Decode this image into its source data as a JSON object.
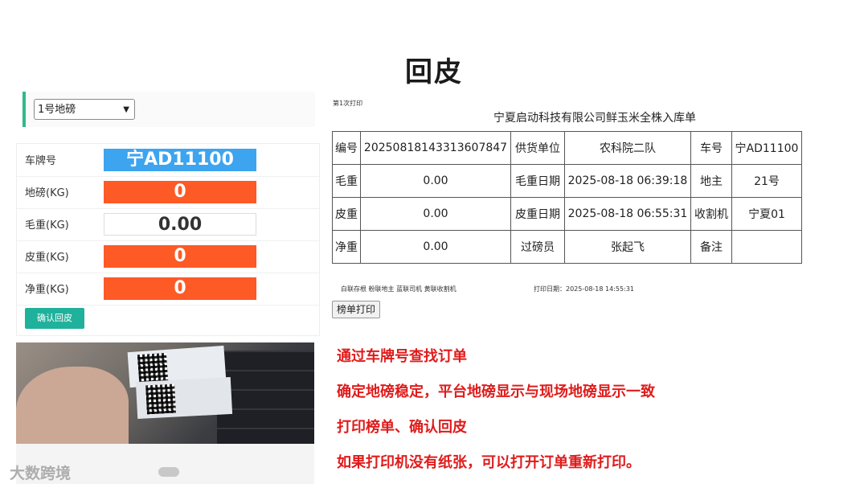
{
  "page_title": "回皮",
  "scale_select": {
    "value": "1号地磅"
  },
  "form": {
    "rows": [
      {
        "label": "车牌号",
        "value": "宁AD11100",
        "color": "#3da4ef"
      },
      {
        "label": "地磅(KG)",
        "value": "0",
        "color": "#fd5a26"
      },
      {
        "label": "毛重(KG)",
        "value": "0.00",
        "color": "#ffffff"
      },
      {
        "label": "皮重(KG)",
        "value": "0",
        "color": "#fd5a26"
      },
      {
        "label": "净重(KG)",
        "value": "0",
        "color": "#fd5a26"
      }
    ],
    "confirm_label": "确认回皮"
  },
  "watermark": "大数跨境",
  "slip": {
    "print_count": "第1次打印",
    "title": "宁夏启动科技有限公司鲜玉米全株入库单",
    "rows": [
      [
        "编号",
        "20250818143313607847",
        "供货单位",
        "农科院二队",
        "车号",
        "宁AD11100"
      ],
      [
        "毛重",
        "0.00",
        "毛重日期",
        "2025-08-18 06:39:18",
        "地主",
        "21号"
      ],
      [
        "皮重",
        "0.00",
        "皮重日期",
        "2025-08-18 06:55:31",
        "收割机",
        "宁夏01"
      ],
      [
        "净重",
        "0.00",
        "过磅员",
        "张起飞",
        "备注",
        ""
      ]
    ],
    "footer_left": "白联存根  粉联地主  蓝联司机  黄联收割机",
    "footer_right": "打印日期：2025-08-18 14:55:31",
    "print_button": "榜单打印"
  },
  "notes": [
    "通过车牌号查找订单",
    "确定地磅稳定，平台地磅显示与现场地磅显示一致",
    "打印榜单、确认回皮",
    "如果打印机没有纸张，可以打开订单重新打印。"
  ],
  "colors": {
    "accent_green": "#1fb19b",
    "note_red": "#e01b1b"
  }
}
